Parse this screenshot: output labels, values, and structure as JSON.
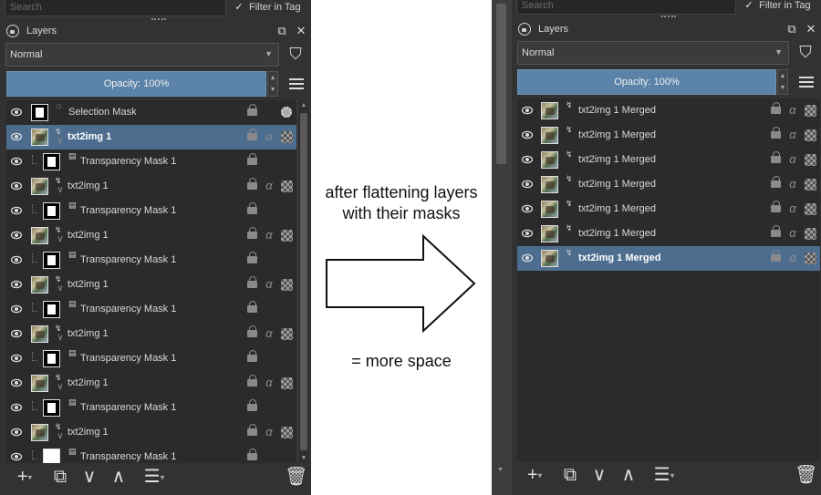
{
  "left_panel": {
    "search_placeholder": "Search",
    "filter_label": "Filter in Tag",
    "docker_title": "Layers",
    "blend_mode": "Normal",
    "opacity_label": "Opacity:  100%",
    "layers": [
      {
        "name": "Selection Mask",
        "kind": "selection",
        "indent": false,
        "selected": false
      },
      {
        "name": "txt2img 1",
        "kind": "paint",
        "indent": false,
        "selected": true
      },
      {
        "name": "Transparency Mask 1",
        "kind": "mask",
        "indent": true,
        "selected": false
      },
      {
        "name": "txt2img 1",
        "kind": "paint",
        "indent": false,
        "selected": false
      },
      {
        "name": "Transparency Mask 1",
        "kind": "mask",
        "indent": true,
        "selected": false
      },
      {
        "name": "txt2img 1",
        "kind": "paint",
        "indent": false,
        "selected": false
      },
      {
        "name": "Transparency Mask 1",
        "kind": "mask",
        "indent": true,
        "selected": false
      },
      {
        "name": "txt2img 1",
        "kind": "paint",
        "indent": false,
        "selected": false
      },
      {
        "name": "Transparency Mask 1",
        "kind": "mask",
        "indent": true,
        "selected": false
      },
      {
        "name": "txt2img 1",
        "kind": "paint",
        "indent": false,
        "selected": false
      },
      {
        "name": "Transparency Mask 1",
        "kind": "mask",
        "indent": true,
        "selected": false
      },
      {
        "name": "txt2img 1",
        "kind": "paint",
        "indent": false,
        "selected": false
      },
      {
        "name": "Transparency Mask 1",
        "kind": "mask",
        "indent": true,
        "selected": false
      },
      {
        "name": "txt2img 1",
        "kind": "paint",
        "indent": false,
        "selected": false
      },
      {
        "name": "Transparency Mask 1",
        "kind": "mask-white",
        "indent": true,
        "selected": false
      }
    ]
  },
  "right_panel": {
    "search_placeholder": "Search",
    "filter_label": "Filter in Tag",
    "docker_title": "Layers",
    "blend_mode": "Normal",
    "opacity_label": "Opacity:  100%",
    "layers": [
      {
        "name": "txt2img 1 Merged",
        "selected": false
      },
      {
        "name": "txt2img 1 Merged",
        "selected": false
      },
      {
        "name": "txt2img 1 Merged",
        "selected": false
      },
      {
        "name": "txt2img 1 Merged",
        "selected": false
      },
      {
        "name": "txt2img 1 Merged",
        "selected": false
      },
      {
        "name": "txt2img 1 Merged",
        "selected": false
      },
      {
        "name": "txt2img 1 Merged",
        "selected": true
      }
    ]
  },
  "annotation": {
    "caption": "after flattening layers with their masks",
    "result": "= more space"
  },
  "icons": {
    "visibility": "eye-icon",
    "lock": "padlock-icon",
    "alpha": "alpha-lock-icon",
    "inherit_alpha": "checker-icon",
    "add": "plus-icon",
    "duplicate": "duplicate-icon",
    "move_down": "chevron-down-icon",
    "move_up": "chevron-up-icon",
    "properties": "sliders-icon",
    "delete": "trash-icon"
  },
  "colors": {
    "panel_bg": "#323232",
    "selected_row": "#4d6d8f",
    "opacity_bar": "#5b83a9"
  }
}
